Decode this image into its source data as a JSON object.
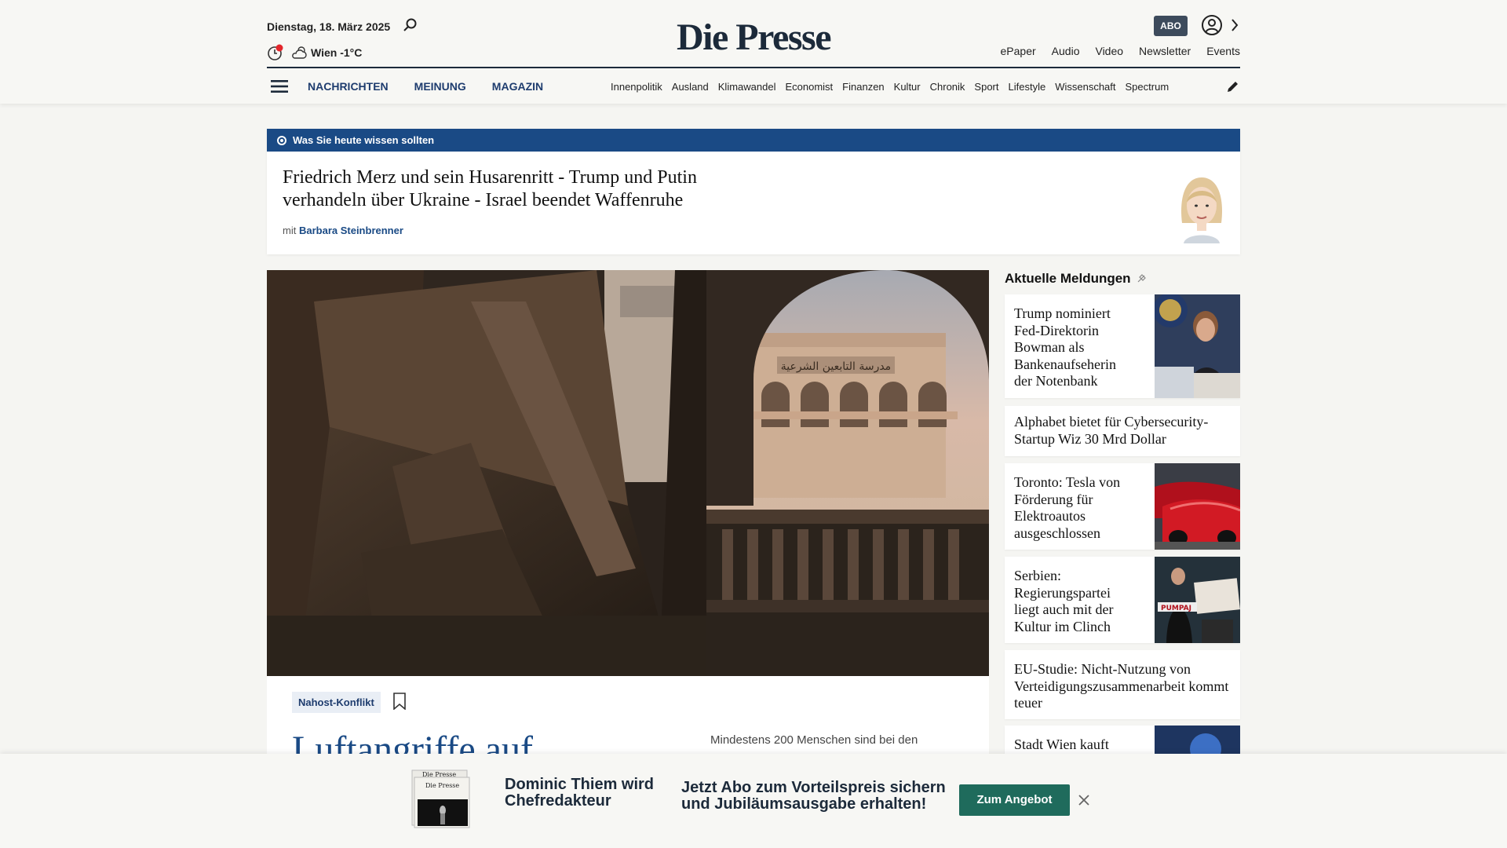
{
  "header": {
    "date": "Dienstag, 18. März 2025",
    "weather": "Wien -1°C",
    "logo": "Die Presse",
    "abo_label": "ABO",
    "top_links": [
      "ePaper",
      "Audio",
      "Video",
      "Newsletter",
      "Events"
    ],
    "main_nav": [
      "NACHRICHTEN",
      "MEINUNG",
      "MAGAZIN"
    ],
    "sub_nav": [
      "Innenpolitik",
      "Ausland",
      "Klimawandel",
      "Economist",
      "Finanzen",
      "Kultur",
      "Chronik",
      "Sport",
      "Lifestyle",
      "Wissenschaft",
      "Spectrum"
    ],
    "colors": {
      "accent": "#1a4a85",
      "logo": "#1c2a3a",
      "notification": "#e3262b"
    }
  },
  "briefing": {
    "label": "Was Sie heute wissen sollten",
    "title": "Friedrich Merz und sein Husarenritt - Trump und Putin verhandeln über Ukraine - Israel beendet Waffenruhe",
    "byline_prefix": "mit",
    "author": "Barbara Steinbrenner"
  },
  "hero": {
    "tag": "Nahost-Konflikt",
    "title": "Luftangriffe auf",
    "teaser": "Mindestens 200 Menschen sind bei den",
    "sign_text": "مدرسة التابعين الشرعية"
  },
  "sidebar": {
    "heading": "Aktuelle Meldungen",
    "items": [
      {
        "title": "Trump nominiert Fed-Direktorin Bowman als Bankenaufseherin der Notenbank"
      },
      {
        "title": "Alphabet bietet für Cybersecurity-Startup Wiz 30 Mrd Dollar"
      },
      {
        "title": "Toronto: Tesla von Förderung für Elektroautos ausgeschlossen"
      },
      {
        "title": "Serbien: Regierungspartei liegt auch mit der Kultur im Clinch",
        "sign_text": "PUMPAJ"
      },
      {
        "title": "EU-Studie: Nicht-Nutzung von Verteidigungszusammenarbeit kommt teuer"
      },
      {
        "title": "Stadt Wien kauft"
      }
    ]
  },
  "promo": {
    "headline": "Dominic Thiem wird Chefredakteur",
    "text": "Jetzt Abo zum Vorteilspreis sichern und Jubiläumsausgabe erhalten!",
    "button": "Zum Angebot",
    "paper_masthead": "Die Presse"
  }
}
